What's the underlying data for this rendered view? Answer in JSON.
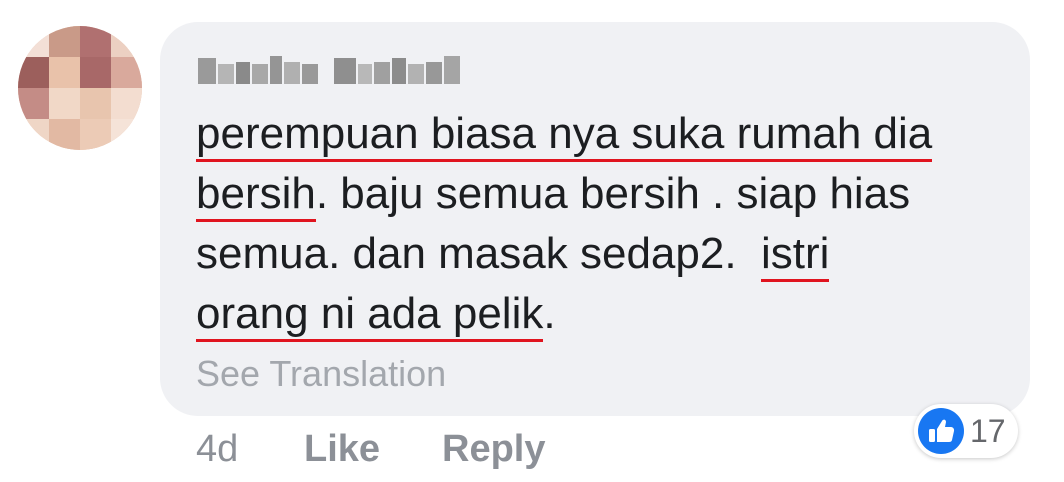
{
  "comment": {
    "author_name": "Zunaida Arshad",
    "text_lines": [
      {
        "parts": [
          {
            "t": "perempuan biasa nya suka rumah dia",
            "hl": true
          }
        ]
      },
      {
        "parts": [
          {
            "t": "bersih",
            "hl": true
          },
          {
            "t": ". baju semua bersih . siap hias",
            "hl": false
          }
        ]
      },
      {
        "parts": [
          {
            "t": "semua. dan masak sedap2.  ",
            "hl": false
          },
          {
            "t": "istri",
            "hl": true
          }
        ]
      },
      {
        "parts": [
          {
            "t": "orang ni ada pelik",
            "hl": true
          },
          {
            "t": ".",
            "hl": false
          }
        ]
      }
    ],
    "see_translation": "See Translation",
    "time": "4d",
    "like_label": "Like",
    "reply_label": "Reply",
    "reaction_count": "17",
    "reaction_icon": "thumbs-up-icon",
    "highlight_color": "#e0141f",
    "accent_color": "#1877f2"
  }
}
